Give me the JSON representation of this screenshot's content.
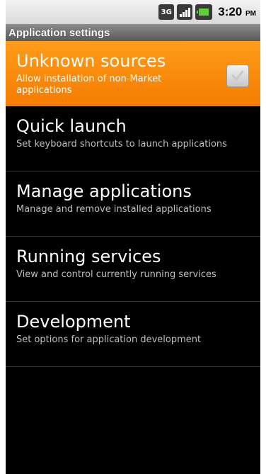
{
  "status_bar": {
    "network_label": "3G",
    "time": "3:20",
    "ampm": "PM",
    "icons": [
      "3g-icon",
      "signal-icon",
      "battery-icon"
    ],
    "battery_color": "#5fd03a"
  },
  "title_bar": {
    "title": "Application settings"
  },
  "accent_color": "#f57c00",
  "items": [
    {
      "title": "Unknown sources",
      "summary": "Allow installation of non-Market applications",
      "checkbox": true,
      "checked": false,
      "selected": true
    },
    {
      "title": "Quick launch",
      "summary": "Set keyboard shortcuts to launch applications"
    },
    {
      "title": "Manage applications",
      "summary": "Manage and remove installed applications"
    },
    {
      "title": "Running services",
      "summary": "View and control currently running services"
    },
    {
      "title": "Development",
      "summary": "Set options for application development"
    }
  ]
}
